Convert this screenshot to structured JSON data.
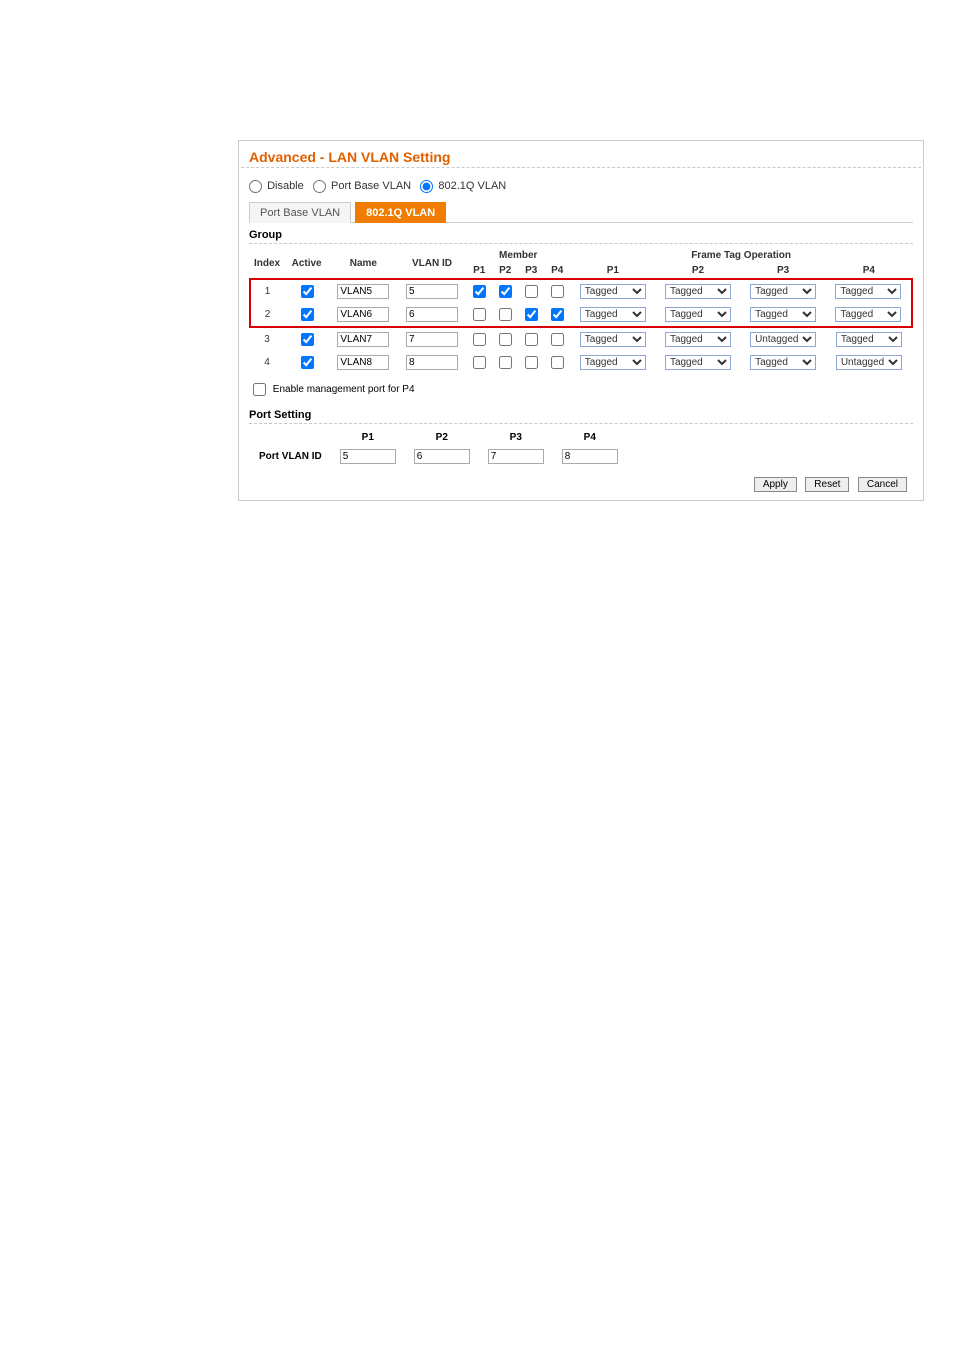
{
  "title": "Advanced - LAN VLAN Setting",
  "vlan_mode": {
    "options": {
      "disable": "Disable",
      "portbase": "Port Base VLAN",
      "dot1q": "802.1Q VLAN"
    },
    "selected": "dot1q"
  },
  "tabs": {
    "portbase": "Port Base VLAN",
    "dot1q": "802.1Q VLAN",
    "active": "dot1q"
  },
  "group": {
    "title": "Group",
    "headers": {
      "index": "Index",
      "active": "Active",
      "name": "Name",
      "vlanid": "VLAN ID",
      "member": "Member",
      "frametag": "Frame Tag Operation",
      "p1": "P1",
      "p2": "P2",
      "p3": "P3",
      "p4": "P4"
    },
    "tag_options": [
      "Tagged",
      "Untagged"
    ],
    "rows": [
      {
        "index": "1",
        "active": true,
        "name": "VLAN5",
        "vlan_id": "5",
        "member": {
          "p1": true,
          "p2": true,
          "p3": false,
          "p4": false
        },
        "tag": {
          "p1": "Tagged",
          "p2": "Tagged",
          "p3": "Tagged",
          "p4": "Tagged"
        }
      },
      {
        "index": "2",
        "active": true,
        "name": "VLAN6",
        "vlan_id": "6",
        "member": {
          "p1": false,
          "p2": false,
          "p3": true,
          "p4": true
        },
        "tag": {
          "p1": "Tagged",
          "p2": "Tagged",
          "p3": "Tagged",
          "p4": "Tagged"
        }
      },
      {
        "index": "3",
        "active": true,
        "name": "VLAN7",
        "vlan_id": "7",
        "member": {
          "p1": false,
          "p2": false,
          "p3": false,
          "p4": false
        },
        "tag": {
          "p1": "Tagged",
          "p2": "Tagged",
          "p3": "Untagged",
          "p4": "Tagged"
        }
      },
      {
        "index": "4",
        "active": true,
        "name": "VLAN8",
        "vlan_id": "8",
        "member": {
          "p1": false,
          "p2": false,
          "p3": false,
          "p4": false
        },
        "tag": {
          "p1": "Tagged",
          "p2": "Tagged",
          "p3": "Tagged",
          "p4": "Untagged"
        }
      }
    ],
    "mgmt_port_label": "Enable management port for P4",
    "mgmt_port_checked": false
  },
  "port_setting": {
    "title": "Port Setting",
    "label": "Port VLAN ID",
    "p1": "5",
    "p2": "6",
    "p3": "7",
    "p4": "8"
  },
  "buttons": {
    "apply": "Apply",
    "reset": "Reset",
    "cancel": "Cancel"
  }
}
